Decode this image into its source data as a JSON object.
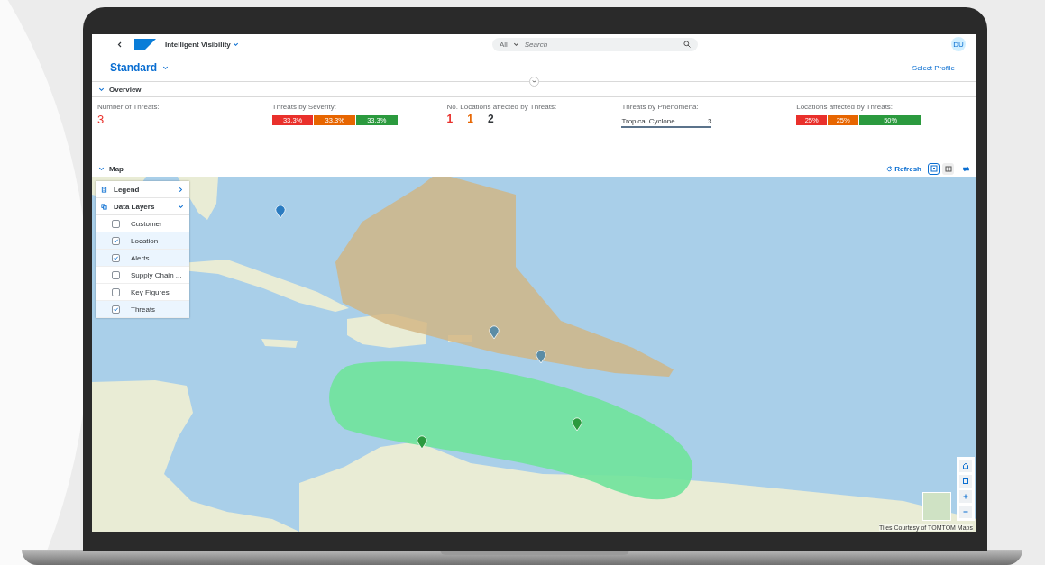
{
  "shell": {
    "app_title": "Intelligent Visibility",
    "search": {
      "scope": "All",
      "placeholder": "Search"
    },
    "avatar": "DU"
  },
  "header": {
    "variant": "Standard",
    "link": "Select Profile"
  },
  "overview": {
    "title": "Overview",
    "expanded": true,
    "kpis": [
      {
        "kind": "number",
        "label": "Number of Threats:",
        "value": "3"
      },
      {
        "kind": "segments",
        "label": "Threats by Severity:",
        "segments": [
          {
            "label": "33.3%",
            "color": "#e9302b"
          },
          {
            "label": "33.3%",
            "color": "#e76500"
          },
          {
            "label": "33.3%",
            "color": "#2b9a3e"
          }
        ]
      },
      {
        "kind": "counts",
        "label": "No. Locations affected by Threats:",
        "counts": [
          {
            "value": "1",
            "color": "#e9302b"
          },
          {
            "value": "1",
            "color": "#e76500"
          },
          {
            "value": "2",
            "color": "#32363a"
          }
        ]
      },
      {
        "kind": "list",
        "label": "Threats by Phenomena:",
        "items": [
          {
            "label": "Tropical Cyclone",
            "value": "3"
          }
        ]
      },
      {
        "kind": "segments",
        "label": "Locations affected by Threats:",
        "segments": [
          {
            "label": "25%",
            "color": "#e9302b"
          },
          {
            "label": "25%",
            "color": "#e76500"
          },
          {
            "label": "50%",
            "color": "#2b9a3e"
          }
        ]
      }
    ]
  },
  "map": {
    "title": "Map",
    "expanded": true,
    "refresh": "Refresh",
    "views": [
      {
        "selected": true
      },
      {
        "selected": false
      }
    ],
    "panel": {
      "sections": [
        {
          "label": "Legend",
          "expanded": false
        },
        {
          "label": "Data Layers",
          "expanded": true
        }
      ],
      "layers": [
        {
          "label": "Customer",
          "checked": false
        },
        {
          "label": "Location",
          "checked": true
        },
        {
          "label": "Alerts",
          "checked": true
        },
        {
          "label": "Supply Chain ...",
          "checked": false
        },
        {
          "label": "Key Figures",
          "checked": false
        },
        {
          "label": "Threats",
          "checked": true
        }
      ]
    },
    "attribution": "Tiles Courtesy of TOMTOM Maps"
  }
}
